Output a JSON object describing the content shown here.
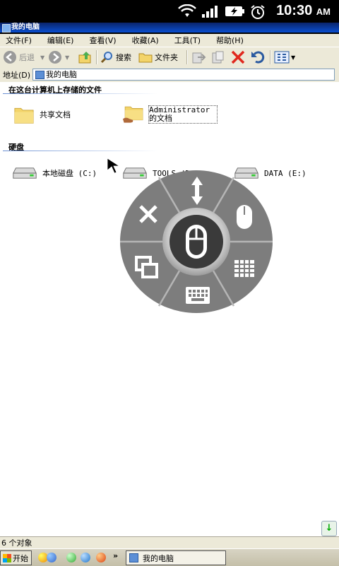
{
  "status_bar": {
    "time": "10:30",
    "ampm": "AM"
  },
  "window": {
    "title": "我的电脑"
  },
  "menu": [
    "文件(F)",
    "编辑(E)",
    "查看(V)",
    "收藏(A)",
    "工具(T)",
    "帮助(H)"
  ],
  "toolbar": {
    "back": "后退",
    "search": "搜索",
    "folders": "文件夹"
  },
  "address": {
    "label": "地址(D)",
    "value": "我的电脑"
  },
  "groups": {
    "files": "在这台计算机上存储的文件",
    "disks": "硬盘"
  },
  "folders": [
    {
      "name": "共享文档"
    },
    {
      "name": "Administrator 的文档"
    }
  ],
  "drives": [
    {
      "name": "本地磁盘 (C:)"
    },
    {
      "name": "TOOLS (D:)"
    },
    {
      "name": "DATA (E:)"
    }
  ],
  "statusline": {
    "text": "6 个对象"
  },
  "taskbar": {
    "start": "开始",
    "window": "我的电脑",
    "chevron": "»"
  },
  "colors": {
    "title": "#0a246a",
    "chrome": "#ece9d8",
    "folder": "#f3d46a"
  }
}
